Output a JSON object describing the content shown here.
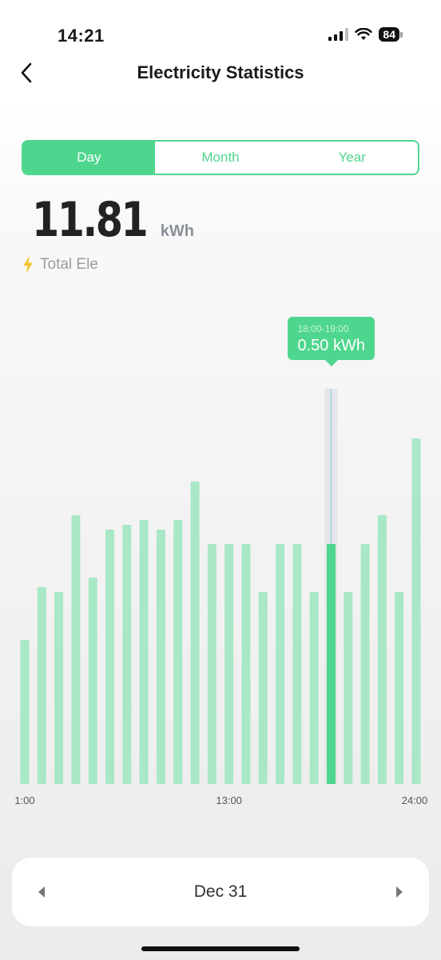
{
  "status_bar": {
    "time": "14:21",
    "battery": "84"
  },
  "nav": {
    "title": "Electricity Statistics",
    "back_icon": "chevron-left-icon"
  },
  "tabs": [
    {
      "label": "Day",
      "active": true
    },
    {
      "label": "Month",
      "active": false
    },
    {
      "label": "Year",
      "active": false
    }
  ],
  "summary": {
    "value_int": "11",
    "value_dec": ".81",
    "unit": "kWh",
    "label": "Total Ele",
    "icon": "lightning-icon"
  },
  "tooltip": {
    "range": "18:00-19:00",
    "value": "0.50 kWh"
  },
  "chart_data": {
    "type": "bar",
    "categories": [
      "1:00",
      "2:00",
      "3:00",
      "4:00",
      "5:00",
      "6:00",
      "7:00",
      "8:00",
      "9:00",
      "10:00",
      "11:00",
      "12:00",
      "13:00",
      "14:00",
      "15:00",
      "16:00",
      "17:00",
      "18:00",
      "19:00",
      "20:00",
      "21:00",
      "22:00",
      "23:00",
      "24:00"
    ],
    "values": [
      0.3,
      0.41,
      0.4,
      0.56,
      0.43,
      0.53,
      0.54,
      0.55,
      0.53,
      0.55,
      0.63,
      0.5,
      0.5,
      0.5,
      0.4,
      0.5,
      0.5,
      0.4,
      0.5,
      0.4,
      0.5,
      0.56,
      0.4,
      0.72
    ],
    "x_tick_labels": [
      "1:00",
      "13:00",
      "24:00"
    ],
    "selected_index": 18,
    "ylim": [
      0,
      0.8
    ],
    "bar_color": "#a8e8c6",
    "selected_color": "#4fd68e",
    "grid": false
  },
  "date_nav": {
    "label": "Dec 31",
    "prev_icon": "triangle-left-icon",
    "next_icon": "triangle-right-icon"
  },
  "colors": {
    "accent": "#4fd68e",
    "bolt": "#f5c431"
  }
}
